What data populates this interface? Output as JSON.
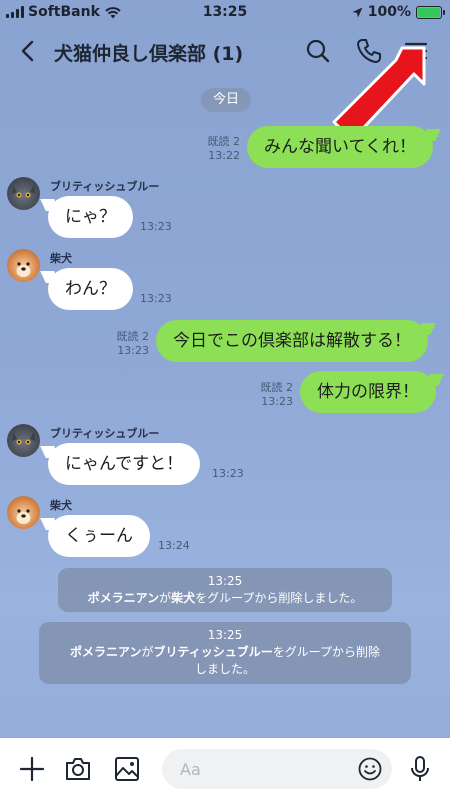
{
  "status_bar": {
    "carrier": "SoftBank",
    "time": "13:25",
    "battery": "100%"
  },
  "header": {
    "title": "犬猫仲良し倶楽部 (1)"
  },
  "date_divider": "今日",
  "messages": [
    {
      "side": "me",
      "text": "みんな聞いてくれ！",
      "read": "既読 2",
      "time": "13:22"
    },
    {
      "side": "them",
      "sender": "ブリティッシュブルー",
      "text": "にゃ？",
      "time": "13:23"
    },
    {
      "side": "them",
      "sender": "柴犬",
      "text": "わん？",
      "time": "13:23"
    },
    {
      "side": "me",
      "text": "今日でこの倶楽部は解散する！",
      "read": "既読 2",
      "time": "13:23"
    },
    {
      "side": "me",
      "text": "体力の限界！",
      "read": "既読 2",
      "time": "13:23"
    },
    {
      "side": "them",
      "sender": "ブリティッシュブルー",
      "text": "にゃんですと！",
      "time": "13:23"
    },
    {
      "side": "them",
      "sender": "柴犬",
      "text": "くぅーん",
      "time": "13:24"
    }
  ],
  "notices": [
    {
      "time": "13:25",
      "actor": "ポメラニアン",
      "ga": "が",
      "target": "柴犬",
      "rest": "をグループから削除しました。"
    },
    {
      "time": "13:25",
      "actor": "ポメラニアン",
      "ga": "が",
      "target": "ブリティッシュブルー",
      "rest": "をグループから削除",
      "rest2": "しました。"
    }
  ],
  "composer": {
    "placeholder": "Aa"
  },
  "icons": {
    "back": "chevron-left-icon",
    "search": "search-icon",
    "call": "phone-icon",
    "menu": "hamburger-menu-icon",
    "plus": "plus-icon",
    "camera": "camera-icon",
    "image": "image-icon",
    "emoji": "emoji-icon",
    "mic": "microphone-icon"
  },
  "colors": {
    "my_bubble": "#8de055",
    "their_bubble": "#ffffff",
    "background": "#8da6d4",
    "annotation_arrow": "#e8141b"
  }
}
